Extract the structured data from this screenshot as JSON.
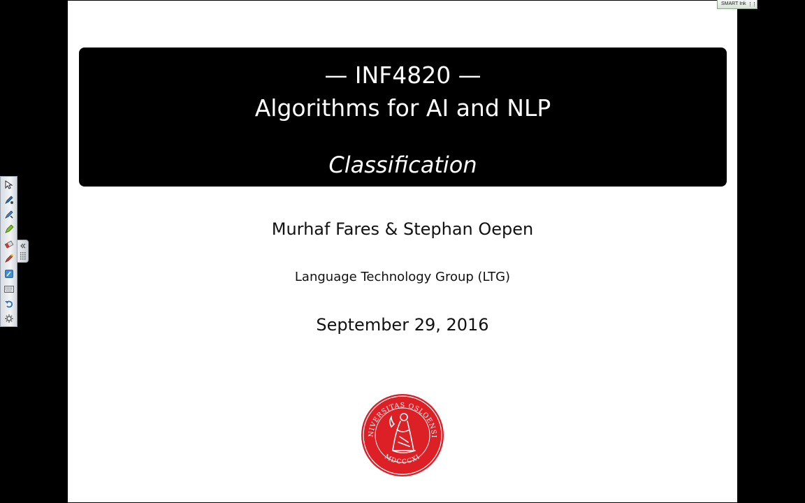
{
  "slide": {
    "title_line1": "— INF4820 —",
    "title_line2": "Algorithms for AI and NLP",
    "subtitle": "Classification",
    "authors": "Murhaf Fares & Stephan Oepen",
    "affiliation": "Language Technology Group (LTG)",
    "date": "September 29, 2016",
    "seal": {
      "top_text": "UNIVERSITAS OSLOENSIS",
      "bottom_text": "MDCCCXI",
      "color": "#dd1f26"
    }
  },
  "smart_ink": {
    "label": "SMART Ink"
  },
  "toolbar": {
    "tools": [
      "select-arrow-icon",
      "pen-icon",
      "highlighter-icon",
      "creative-pen-icon",
      "eraser-icon",
      "magic-pen-icon",
      "screen-capture-icon",
      "keyboard-icon",
      "undo-icon",
      "settings-icon"
    ]
  },
  "colors": {
    "background": "#000000",
    "slide": "#ffffff",
    "title_block": "#000000",
    "title_text": "#ffffff",
    "seal_red": "#dd1f26"
  }
}
